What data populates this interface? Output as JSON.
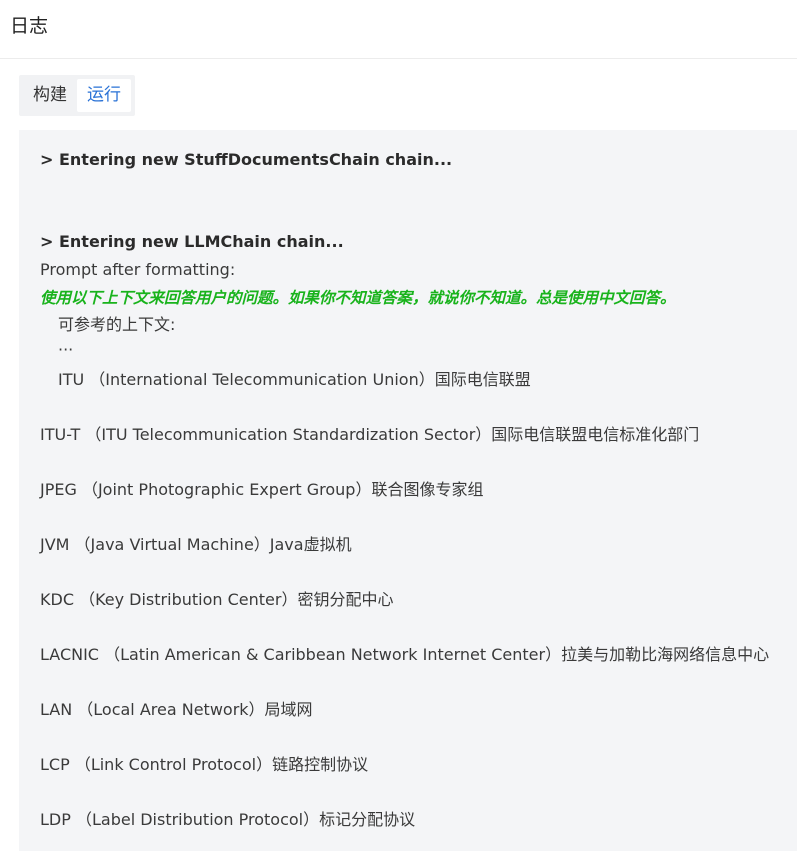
{
  "header": {
    "title": "日志"
  },
  "tabs": [
    {
      "label": "构建",
      "active": false
    },
    {
      "label": "运行",
      "active": true
    }
  ],
  "log": {
    "lines": [
      {
        "text": "> Entering new StuffDocumentsChain chain...",
        "style": "bold"
      },
      {
        "text": "> Entering new LLMChain chain...",
        "style": "bold"
      },
      {
        "text": "Prompt after formatting:",
        "style": "normal"
      },
      {
        "text": "使用以下上下文来回答用户的问题。如果你不知道答案，就说你不知道。总是使用中文回答。",
        "style": "green"
      },
      {
        "text": "可参考的上下文:",
        "style": "indent"
      },
      {
        "text": "···",
        "style": "indent"
      },
      {
        "text": "ITU （International Telecommunication Union）国际电信联盟",
        "style": "indent"
      },
      {
        "text": "ITU-T （ITU Telecommunication Standardization Sector）国际电信联盟电信标准化部门",
        "style": "normal"
      },
      {
        "text": "JPEG （Joint Photographic Expert Group）联合图像专家组",
        "style": "normal"
      },
      {
        "text": "JVM （Java Virtual Machine）Java虚拟机",
        "style": "normal"
      },
      {
        "text": "KDC （Key Distribution Center）密钥分配中心",
        "style": "normal"
      },
      {
        "text": "LACNIC （Latin American & Caribbean Network Internet Center）拉美与加勒比海网络信息中心",
        "style": "normal"
      },
      {
        "text": "LAN （Local Area Network）局域网",
        "style": "normal"
      },
      {
        "text": "LCP （Link Control Protocol）链路控制协议",
        "style": "normal"
      },
      {
        "text": "LDP （Label Distribution Protocol）标记分配协议",
        "style": "normal"
      }
    ]
  },
  "colors": {
    "accent": "#2a72d6",
    "prompt_green": "#19b31c",
    "panel_bg": "#f4f5f7"
  }
}
